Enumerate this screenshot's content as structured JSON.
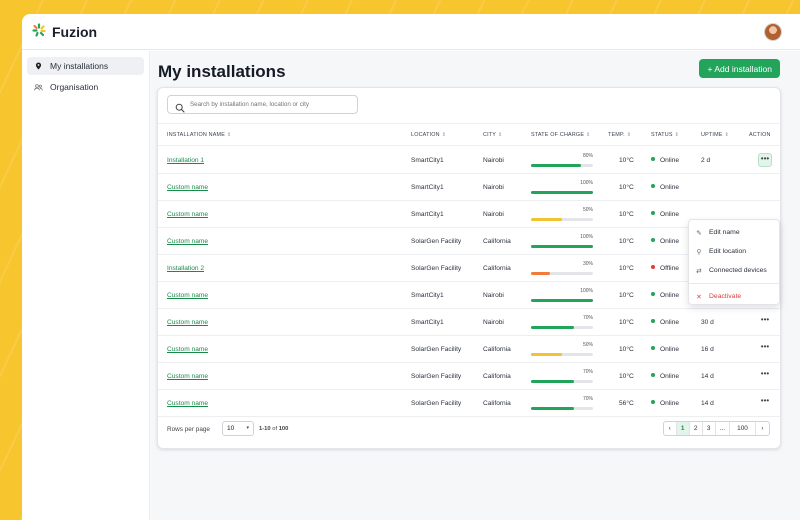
{
  "app": {
    "name": "Fuzion"
  },
  "sidebar": {
    "items": [
      {
        "label": "My installations",
        "icon": "location-pin-icon",
        "active": true
      },
      {
        "label": "Organisation",
        "icon": "people-icon",
        "active": false
      }
    ]
  },
  "main": {
    "title": "My installations",
    "add_button": "+ Add installation",
    "search_placeholder": "Search by installation name, location or city"
  },
  "table": {
    "columns": [
      "INSTALLATION NAME",
      "LOCATION",
      "CITY",
      "STATE OF CHARGE",
      "TEMP.",
      "STATUS",
      "UPTIME",
      "ACTION"
    ],
    "rows": [
      {
        "name": "Installation 1",
        "location": "SmartCity1",
        "city": "Nairobi",
        "charge": "80%",
        "charge_value": 80,
        "charge_color": "#22a45a",
        "temp": "10°C",
        "status": "Online",
        "status_color": "#22a45a",
        "uptime": "2 d",
        "action": "•••"
      },
      {
        "name": "Custom name",
        "location": "SmartCity1",
        "city": "Nairobi",
        "charge": "100%",
        "charge_value": 100,
        "charge_color": "#22a45a",
        "temp": "10°C",
        "status": "Online",
        "status_color": "#22a45a",
        "uptime": "",
        "action": ""
      },
      {
        "name": "Custom name",
        "location": "SmartCity1",
        "city": "Nairobi",
        "charge": "50%",
        "charge_value": 50,
        "charge_color": "#f2c230",
        "temp": "10°C",
        "status": "Online",
        "status_color": "#22a45a",
        "uptime": "",
        "action": ""
      },
      {
        "name": "Custom name",
        "location": "SolarGen Facility",
        "city": "California",
        "charge": "100%",
        "charge_value": 100,
        "charge_color": "#22a45a",
        "temp": "10°C",
        "status": "Online",
        "status_color": "#22a45a",
        "uptime": "",
        "action": ""
      },
      {
        "name": "Installation 2",
        "location": "SolarGen Facility",
        "city": "California",
        "charge": "30%",
        "charge_value": 30,
        "charge_color": "#f07c3c",
        "temp": "10°C",
        "status": "Offline",
        "status_color": "#e23b3b",
        "uptime": "N/A",
        "action": "•••"
      },
      {
        "name": "Custom name",
        "location": "SmartCity1",
        "city": "Nairobi",
        "charge": "100%",
        "charge_value": 100,
        "charge_color": "#22a45a",
        "temp": "10°C",
        "status": "Online",
        "status_color": "#22a45a",
        "uptime": "15 min",
        "action": "•••"
      },
      {
        "name": "Custom name",
        "location": "SmartCity1",
        "city": "Nairobi",
        "charge": "70%",
        "charge_value": 70,
        "charge_color": "#22a45a",
        "temp": "10°C",
        "status": "Online",
        "status_color": "#22a45a",
        "uptime": "30 d",
        "action": "•••"
      },
      {
        "name": "Custom name",
        "location": "SolarGen Facility",
        "city": "California",
        "charge": "50%",
        "charge_value": 50,
        "charge_color": "#f2c230",
        "temp": "10°C",
        "status": "Online",
        "status_color": "#22a45a",
        "uptime": "16 d",
        "action": "•••"
      },
      {
        "name": "Custom name",
        "location": "SolarGen Facility",
        "city": "California",
        "charge": "70%",
        "charge_value": 70,
        "charge_color": "#22a45a",
        "temp": "10°C",
        "status": "Online",
        "status_color": "#22a45a",
        "uptime": "14 d",
        "action": "•••"
      },
      {
        "name": "Custom name",
        "location": "SolarGen Facility",
        "city": "California",
        "charge": "70%",
        "charge_value": 70,
        "charge_color": "#22a45a",
        "temp": "56°C",
        "status": "Online",
        "status_color": "#22a45a",
        "uptime": "14 d",
        "action": "•••"
      }
    ]
  },
  "action_menu": {
    "items": [
      {
        "label": "Edit name",
        "icon": "pencil-icon",
        "glyph": "✎"
      },
      {
        "label": "Edit location",
        "icon": "location-pin-icon",
        "glyph": "⚲"
      },
      {
        "label": "Connected devices",
        "icon": "link-icon",
        "glyph": "⇄"
      }
    ],
    "danger_item": {
      "label": "Deactivate",
      "icon": "close-icon",
      "glyph": "✕"
    }
  },
  "footer": {
    "rows_per_page_label": "Rows per page",
    "rows_per_page_value": "10",
    "range_prefix": "1-10",
    "range_of": "of",
    "range_total": "100",
    "pages": [
      "‹",
      "1",
      "2",
      "3",
      "...",
      "100",
      "›"
    ],
    "active_page": "1"
  },
  "colors": {
    "brand": "#22a45a",
    "background": "#f7c52e",
    "danger": "#e23b3b"
  }
}
